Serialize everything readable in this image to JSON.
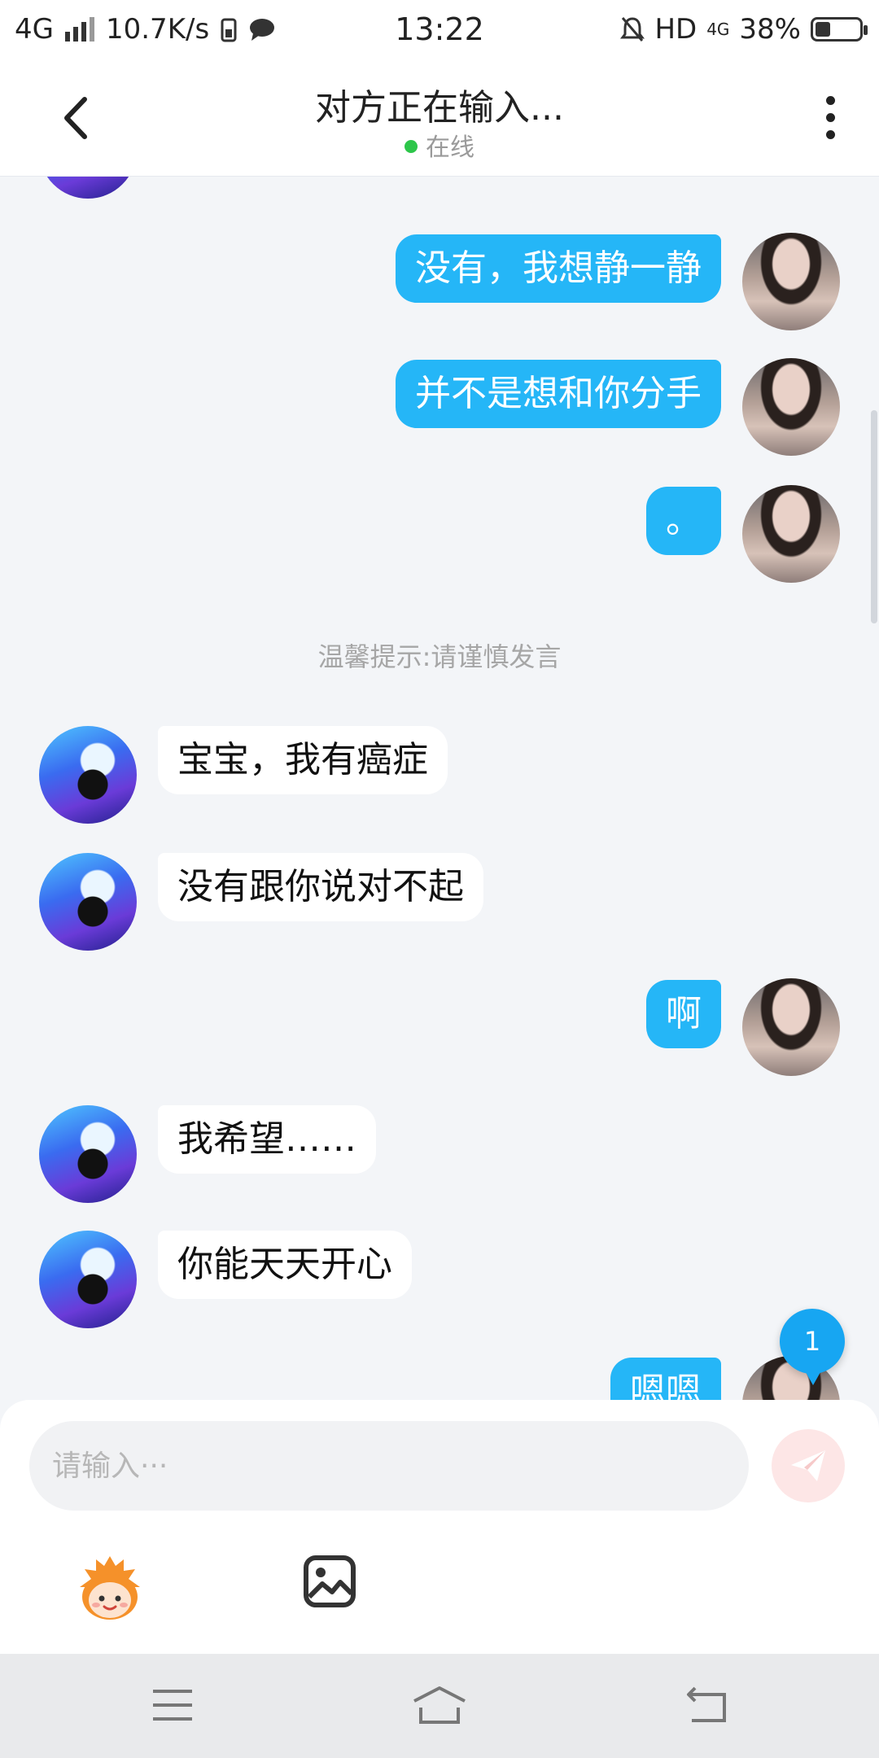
{
  "status_bar": {
    "network": "4G",
    "speed": "10.7K/s",
    "time": "13:22",
    "hd": "HD",
    "network2": "4G",
    "battery": "38%"
  },
  "header": {
    "title": "对方正在输入...",
    "status": "在线"
  },
  "chat": {
    "messages": [
      {
        "from": "me",
        "text": "没有，我想静一静"
      },
      {
        "from": "me",
        "text": "并不是想和你分手"
      },
      {
        "from": "me",
        "text": "。"
      },
      {
        "from": "system",
        "text": "温馨提示:请谨慎发言"
      },
      {
        "from": "other",
        "text": "宝宝，我有癌症"
      },
      {
        "from": "other",
        "text": "没有跟你说对不起"
      },
      {
        "from": "me",
        "text": "啊"
      },
      {
        "from": "other",
        "text": "我希望……"
      },
      {
        "from": "other",
        "text": "你能天天开心"
      },
      {
        "from": "me",
        "text": "嗯嗯"
      }
    ],
    "unread_badge": "1"
  },
  "input": {
    "placeholder": "请输入···"
  },
  "icons": {
    "back": "back-arrow-icon",
    "more": "more-vertical-icon",
    "send": "send-icon",
    "emoji": "emoji-icon",
    "image": "image-icon",
    "menu": "menu-icon",
    "home": "home-icon",
    "back_nav": "return-icon"
  },
  "colors": {
    "my_bubble": "#25b6f7",
    "their_bubble": "#ffffff",
    "online": "#2dc64a",
    "badge": "#17a6f2"
  }
}
